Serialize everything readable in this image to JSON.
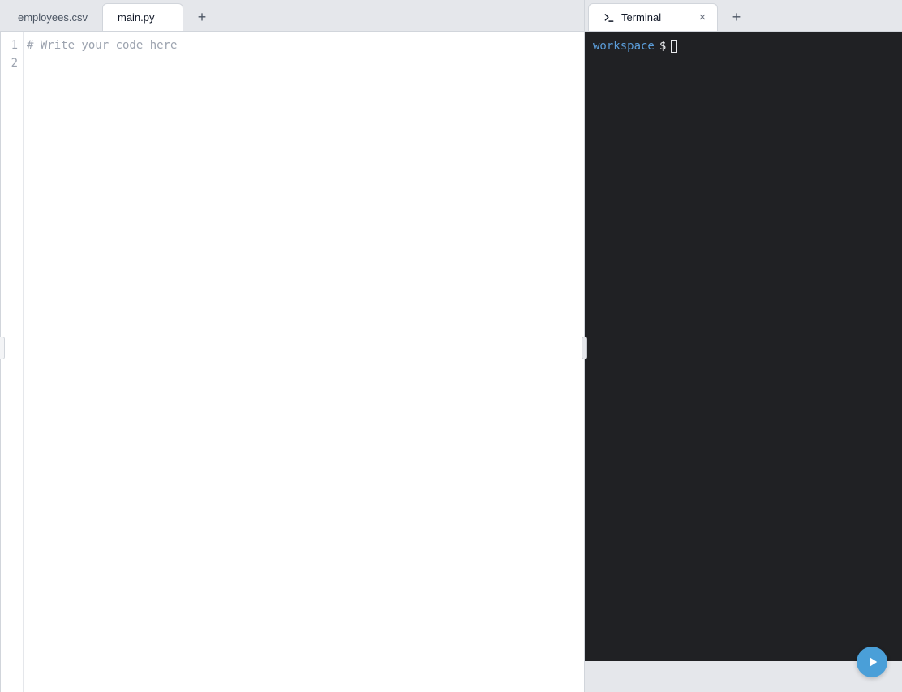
{
  "editor": {
    "tabs": [
      {
        "label": "employees.csv",
        "active": false
      },
      {
        "label": "main.py",
        "active": true
      }
    ],
    "gutter_lines": [
      "1",
      "2"
    ],
    "code_lines": [
      {
        "text": "# Write your code here",
        "type": "comment"
      },
      {
        "text": "",
        "type": "blank"
      }
    ]
  },
  "terminal": {
    "tab_label": "Terminal",
    "prompt_path": "workspace",
    "prompt_symbol": "$"
  },
  "icons": {
    "plus": "+",
    "close": "×"
  }
}
